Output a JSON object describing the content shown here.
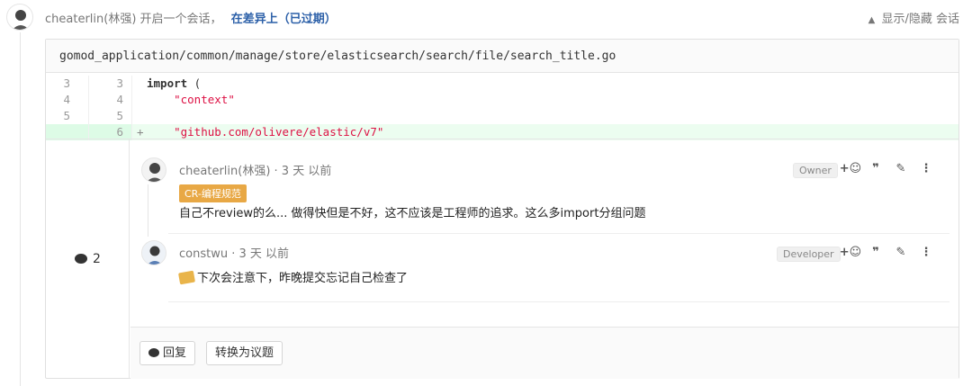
{
  "header": {
    "author": "cheaterlin(林强)",
    "action_text": "开启一个会话，",
    "link_text": "在差异上（已过期）",
    "toggle_label": "显示/隐藏 会话"
  },
  "file": {
    "path": "gomod_application/common/manage/store/elasticsearch/search/file/search_title.go"
  },
  "diff": [
    {
      "old": "3",
      "new": "3",
      "sign": "",
      "keyword": "import",
      "rest": " (",
      "string": ""
    },
    {
      "old": "4",
      "new": "4",
      "sign": "",
      "keyword": "",
      "rest": "    ",
      "string": "\"context\""
    },
    {
      "old": "5",
      "new": "5",
      "sign": "",
      "keyword": "",
      "rest": "",
      "string": ""
    },
    {
      "old": "",
      "new": "6",
      "sign": "+",
      "keyword": "",
      "rest": "    ",
      "string": "\"github.com/olivere/elastic/v7\""
    }
  ],
  "discussion": {
    "count": "2",
    "notes": [
      {
        "author": "cheaterlin(林强)",
        "time": " · 3 天 以前",
        "role": "Owner",
        "label": "CR-编程规范",
        "body": "自己不review的么... 做得快但是不好，这不应该是工程师的追求。这么多import分组问题"
      },
      {
        "author": "constwu",
        "time": " · 3 天 以前",
        "role": "Developer",
        "body": "下次会注意下，昨晚提交忘记自己检查了"
      }
    ],
    "actions": {
      "emoji": "+☺",
      "quote": "❞",
      "edit": "✎",
      "more": "⋮"
    },
    "reply_label": "回复",
    "convert_label": "转换为议题"
  }
}
